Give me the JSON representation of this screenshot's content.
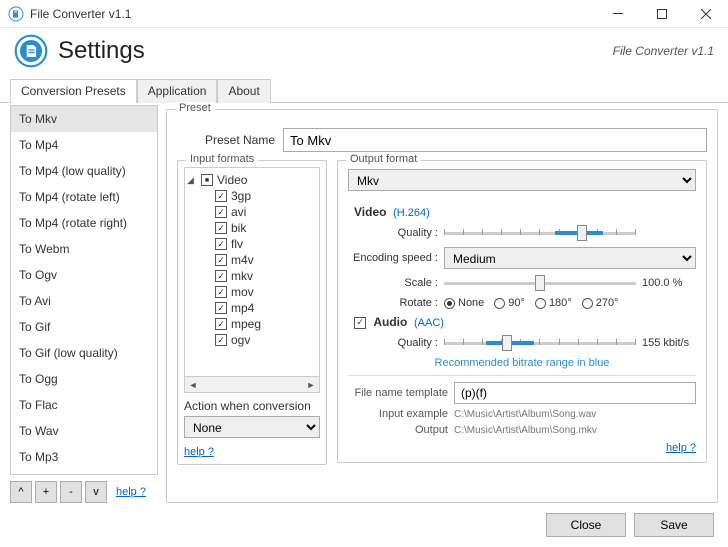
{
  "window": {
    "title": "File Converter v1.1",
    "heading": "Settings",
    "subtitle": "File Converter v1.1"
  },
  "tabs": [
    {
      "label": "Conversion Presets",
      "active": true
    },
    {
      "label": "Application",
      "active": false
    },
    {
      "label": "About",
      "active": false
    }
  ],
  "presets": [
    "To Mkv",
    "To Mp4",
    "To Mp4 (low quality)",
    "To Mp4 (rotate left)",
    "To Mp4 (rotate right)",
    "To Webm",
    "To Ogv",
    "To Avi",
    "To Gif",
    "To Gif (low quality)",
    "To Ogg",
    "To Flac",
    "To Wav",
    "To Mp3"
  ],
  "selected_preset_index": 0,
  "list_buttons": [
    "^",
    "+",
    "-",
    "v"
  ],
  "help_label": "help ?",
  "preset_panel": {
    "legend": "Preset",
    "name_label": "Preset Name",
    "name_value": "To Mkv",
    "inputs": {
      "legend": "Input formats",
      "group": "Video",
      "formats": [
        "3gp",
        "avi",
        "bik",
        "flv",
        "m4v",
        "mkv",
        "mov",
        "mp4",
        "mpeg",
        "ogv"
      ],
      "action_label": "Action when conversion",
      "action_value": "None"
    },
    "output": {
      "legend": "Output format",
      "format": "Mkv",
      "video": {
        "heading": "Video",
        "codec": "(H.264)",
        "quality_label": "Quality :",
        "encoding_label": "Encoding speed :",
        "encoding_value": "Medium",
        "scale_label": "Scale :",
        "scale_value": "100.0 %",
        "rotate_label": "Rotate :",
        "rotate_options": [
          "None",
          "90°",
          "180°",
          "270°"
        ],
        "rotate_selected": 0
      },
      "audio": {
        "heading": "Audio",
        "codec": "(AAC)",
        "quality_label": "Quality :",
        "quality_value": "155 kbit/s",
        "rec_text": "Recommended bitrate range in blue"
      },
      "file_template": {
        "label": "File name template",
        "value": "(p)(f)",
        "input_example_label": "Input example",
        "input_example_value": "C:\\Music\\Artist\\Album\\Song.wav",
        "output_label": "Output",
        "output_value": "C:\\Music\\Artist\\Album\\Song.mkv"
      }
    }
  },
  "footer": {
    "close": "Close",
    "save": "Save"
  }
}
